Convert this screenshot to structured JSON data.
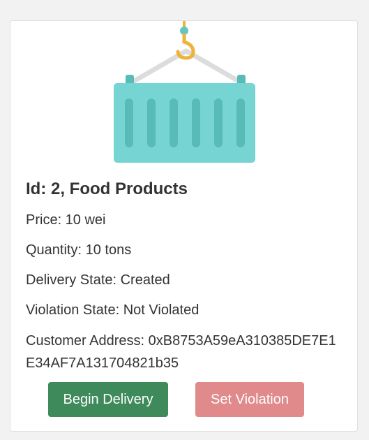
{
  "product": {
    "title": "Id: 2, Food Products",
    "price": "Price: 10 wei",
    "quantity": "Quantity: 10 tons",
    "delivery_state": "Delivery State: Created",
    "violation_state": "Violation State: Not Violated",
    "customer_address": "Customer Address: 0xB8753A59eA310385DE7E1E34AF7A131704821b35"
  },
  "buttons": {
    "begin_delivery": "Begin Delivery",
    "set_violation": "Set Violation"
  },
  "colors": {
    "container": "#76d5d3",
    "container_ribs": "#58bbb7",
    "hook": "#f0b23a",
    "begin_delivery": "#3f8a5b",
    "set_violation": "#e08a8b"
  },
  "icons": {
    "product_image": "shipping-container-icon"
  }
}
